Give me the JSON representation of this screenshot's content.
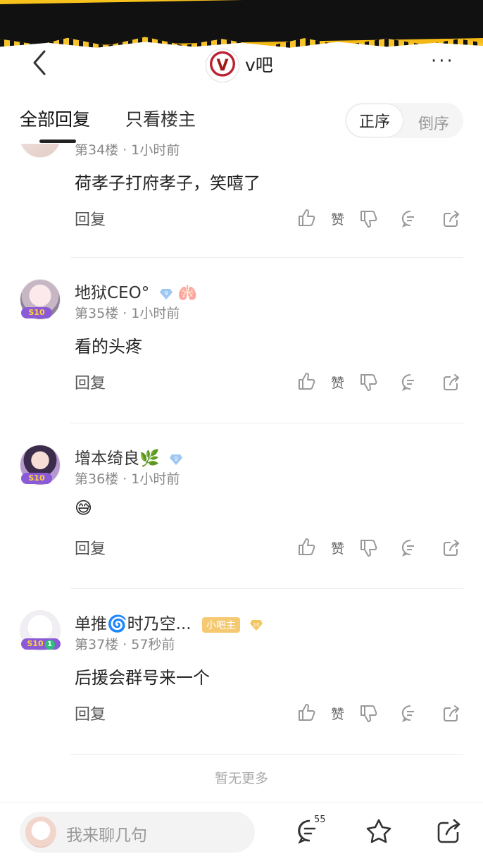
{
  "header": {
    "forum_name": "v吧",
    "logo_letter": "V",
    "more_label": "···"
  },
  "tabs": {
    "all": "全部回复",
    "owner_only": "只看楼主",
    "order_asc": "正序",
    "order_desc": "倒序"
  },
  "posts": [
    {
      "username": "",
      "meta": "第34楼 · 1小时前",
      "content": "荷孝子打府孝子，笑嘻了",
      "reply": "回复",
      "like_label": "赞"
    },
    {
      "username": "地狱CEO°",
      "level": "9",
      "meta": "第35楼 · 1小时前",
      "content": "看的头疼",
      "reply": "回复",
      "like_label": "赞",
      "badge": "S10"
    },
    {
      "username": "增本绮良🌿",
      "level": "9",
      "meta": "第36楼 · 1小时前",
      "content": "😅",
      "reply": "回复",
      "like_label": "赞",
      "badge": "S10"
    },
    {
      "username": "单推🌀时乃空...",
      "tag": "小吧主",
      "level": "10",
      "meta": "第37楼 · 57秒前",
      "content": "后援会群号来一个",
      "reply": "回复",
      "like_label": "赞",
      "badge": "S10",
      "badge_extra": "1"
    }
  ],
  "no_more": "暂无更多",
  "bottom": {
    "input_placeholder": "我来聊几句",
    "comment_count": "55"
  },
  "colors": {
    "banner_yellow": "#f4b713",
    "level_blue": "#9ec7f2",
    "level_gold": "#f2c75e",
    "owner_tag": "#f5c971"
  }
}
